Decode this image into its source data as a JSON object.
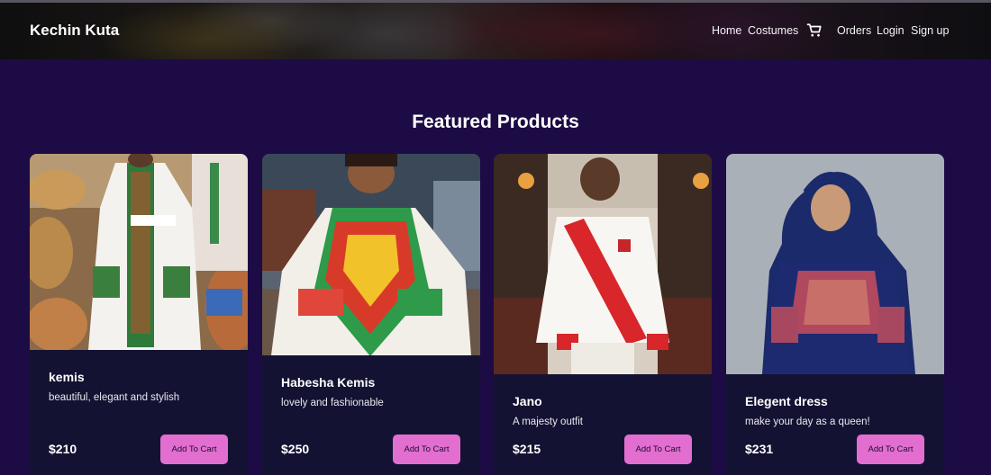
{
  "navbar": {
    "brand": "Kechin Kuta",
    "links": {
      "home": "Home",
      "costumes": "Costumes",
      "orders": "Orders",
      "login": "Login",
      "signup": "Sign up"
    },
    "cart_icon": "shopping-cart-icon"
  },
  "main": {
    "title": "Featured Products",
    "products": [
      {
        "name": "kemis",
        "description": "beautiful, elegant and stylish",
        "price": "$210",
        "button": "Add To Cart"
      },
      {
        "name": "Habesha Kemis",
        "description": "lovely and fashionable",
        "price": "$250",
        "button": "Add To Cart"
      },
      {
        "name": "Jano",
        "description": "A majesty outfit",
        "price": "$215",
        "button": "Add To Cart"
      },
      {
        "name": "Elegent dress",
        "description": "make your day as a queen!",
        "price": "$231",
        "button": "Add To Cart"
      }
    ]
  },
  "colors": {
    "background": "#1d0b45",
    "card": "#141232",
    "button": "#e26ed0"
  }
}
